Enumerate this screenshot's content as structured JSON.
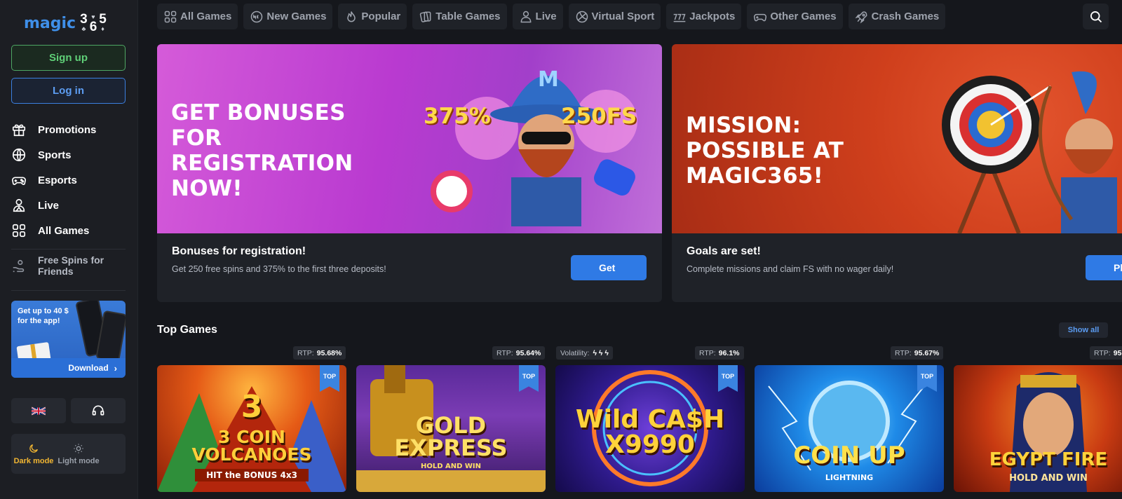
{
  "logo": {
    "word": "magic",
    "digits": [
      {
        "d": "3",
        "s": "♣"
      },
      {
        "d": "6",
        "s": "♥"
      },
      {
        "d": "5",
        "s": "♦"
      }
    ]
  },
  "sidebar": {
    "signup": "Sign up",
    "login": "Log in",
    "items": [
      {
        "label": "Promotions",
        "icon": "gift-icon"
      },
      {
        "label": "Sports",
        "icon": "ball-icon"
      },
      {
        "label": "Esports",
        "icon": "gamepad-icon"
      },
      {
        "label": "Live",
        "icon": "dealer-icon"
      },
      {
        "label": "All Games",
        "icon": "grid-icon"
      }
    ],
    "free_spins": "Free Spins for Friends",
    "promo_text": "Get up to 40 $ for the app!",
    "download": "Download",
    "dark_mode": "Dark mode",
    "light_mode": "Light mode"
  },
  "topnav": [
    "All Games",
    "New Games",
    "Popular",
    "Table Games",
    "Live",
    "Virtual Sport",
    "Jackpots",
    "Other Games",
    "Crash Games"
  ],
  "banners": [
    {
      "headline": "GET BONUSES FOR REGISTRATION NOW!",
      "badge_left": "375%",
      "badge_right": "250FS",
      "title": "Bonuses for registration!",
      "desc": "Get 250 free spins and 375% to the first three deposits!",
      "button": "Get"
    },
    {
      "headline": "MISSION: POSSIBLE AT MAGIC365!",
      "title": "Goals are set!",
      "desc": "Complete missions and claim FS with no wager daily!",
      "button": "Pl"
    }
  ],
  "top_games": {
    "title": "Top Games",
    "show_all": "Show all",
    "rtp_label": "RTP:",
    "volatility_label": "Volatility:",
    "badge": "TOP",
    "games": [
      {
        "name": "3 COIN VOLCANOES",
        "sub": "HIT the BONUS 4x3",
        "rtp": "95.68%"
      },
      {
        "name": "GOLD EXPRESS",
        "sub": "HOLD AND WIN",
        "rtp": "95.64%"
      },
      {
        "name": "Wild CA$H X9990",
        "sub": "",
        "rtp": "96.1%"
      },
      {
        "name": "COIN UP",
        "sub": "LIGHTNING",
        "rtp": "95.67%"
      },
      {
        "name": "EGYPT FIRE",
        "sub": "HOLD AND WIN",
        "rtp": "95"
      }
    ]
  }
}
